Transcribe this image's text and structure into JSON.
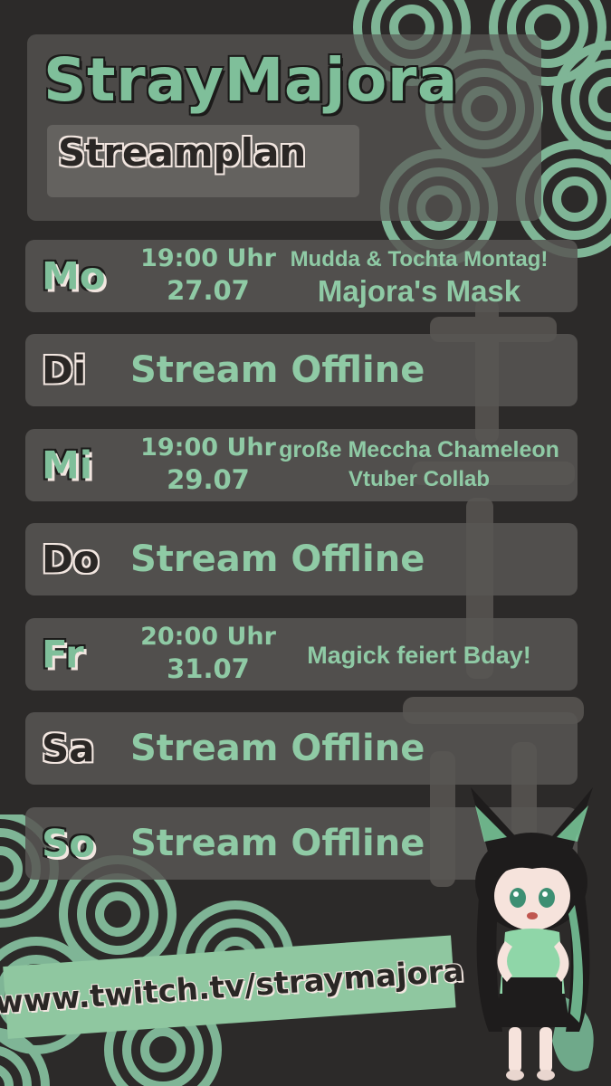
{
  "header": {
    "title": "StrayMajora",
    "subtitle": "Streamplan"
  },
  "schedule": [
    {
      "day": "Mo",
      "time": "19:00 Uhr",
      "date": "27.07",
      "event_line1": "Mudda & Tochta Montag!",
      "event_line2": "Majora's Mask"
    },
    {
      "day": "Di",
      "status": "Stream Offline"
    },
    {
      "day": "Mi",
      "time": "19:00 Uhr",
      "date": "29.07",
      "event_line1": "große Meccha Chameleon",
      "event_line2": "Vtuber Collab"
    },
    {
      "day": "Do",
      "status": "Stream Offline"
    },
    {
      "day": "Fr",
      "time": "20:00 Uhr",
      "date": "31.07",
      "event_line1": "Magick feiert Bday!"
    },
    {
      "day": "Sa",
      "status": "Stream Offline"
    },
    {
      "day": "So",
      "status": "Stream Offline"
    }
  ],
  "footer": {
    "url": "www.twitch.tv/straymajora"
  },
  "colors": {
    "background": "#2c2a29",
    "accent_green": "#8fcaa5",
    "panel": "#585653",
    "outline_light": "#f2e6e0"
  },
  "decor": {
    "pattern": "seigaiha-waves",
    "character": "chibi-fox-girl-vtuber"
  }
}
